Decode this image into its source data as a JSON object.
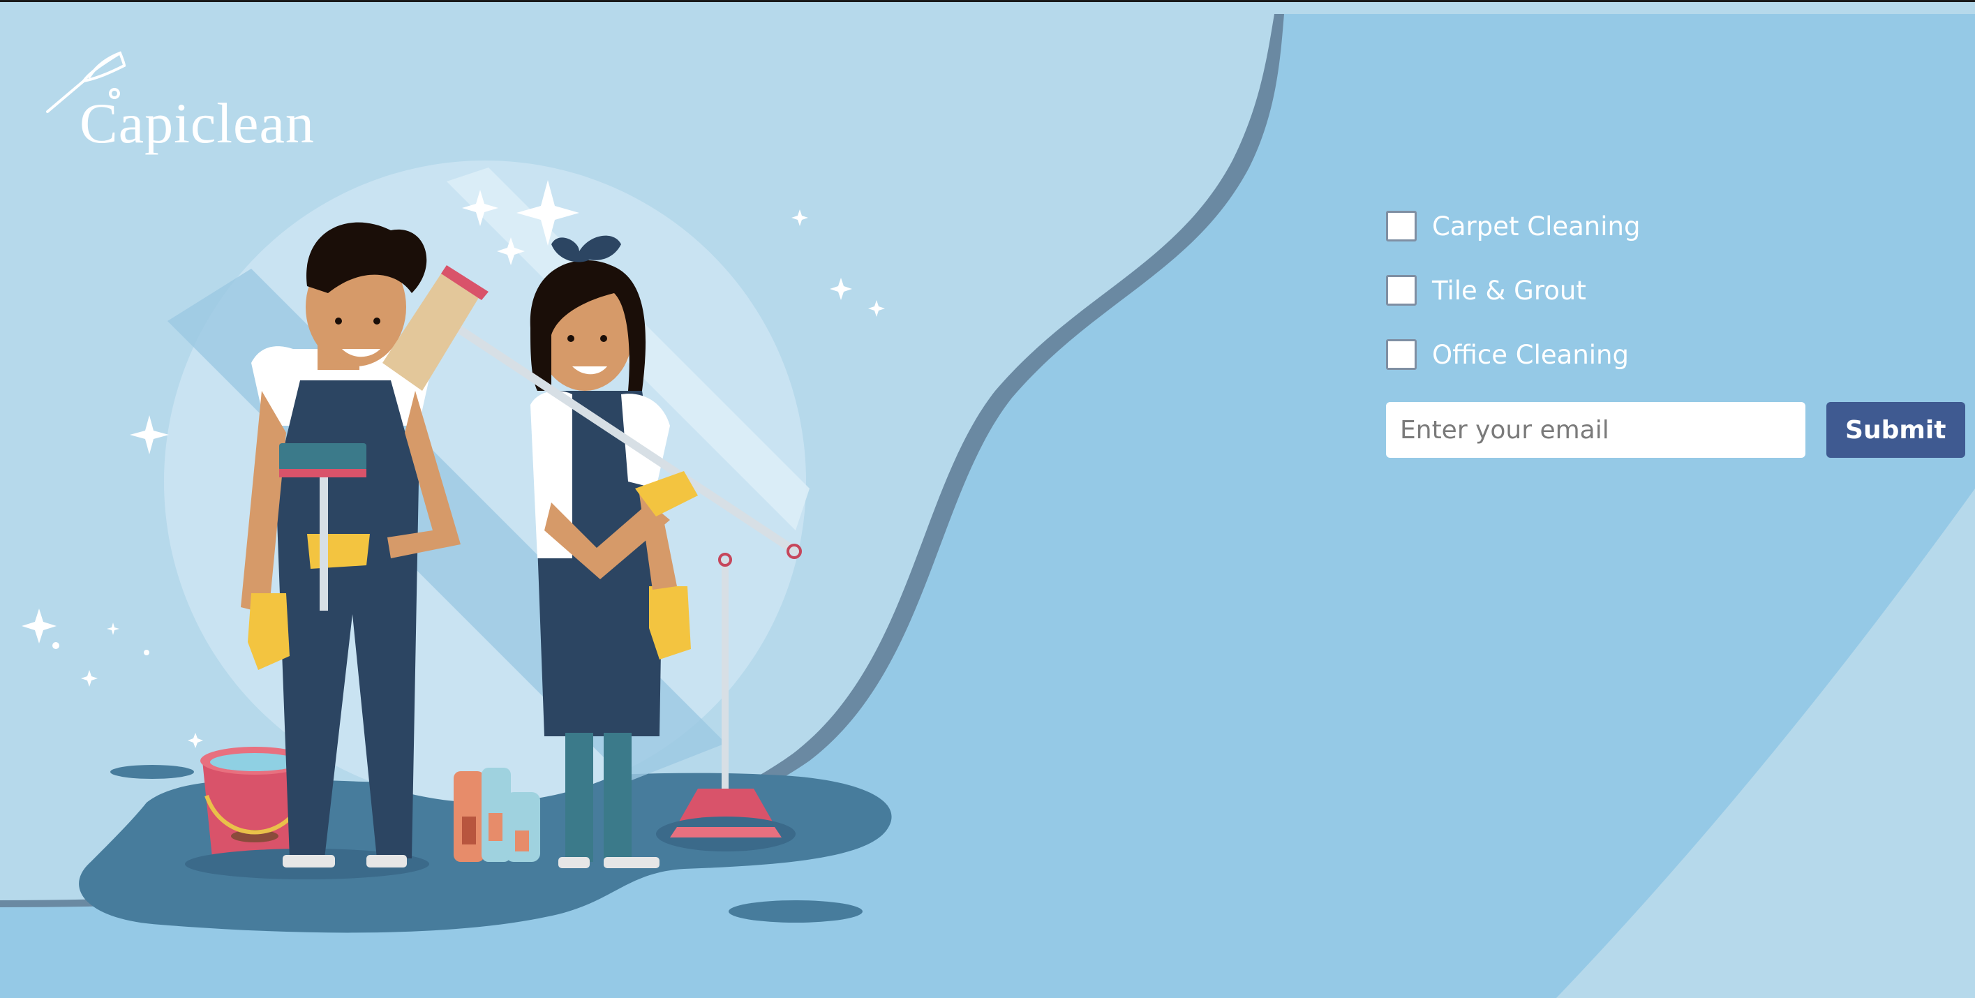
{
  "brand": {
    "name": "Capiclean",
    "logo_icon": "duster-icon"
  },
  "services": [
    {
      "label": "Carpet Cleaning",
      "checked": false
    },
    {
      "label": "Tile & Grout",
      "checked": false
    },
    {
      "label": "Office Cleaning",
      "checked": false
    }
  ],
  "signup": {
    "email_value": "",
    "email_placeholder": "Enter your email",
    "submit_label": "Submit"
  },
  "colors": {
    "background_light": "#b6d9eb",
    "background_panel": "#95c9e6",
    "button": "#3f5a91",
    "overalls": "#2c4562"
  }
}
